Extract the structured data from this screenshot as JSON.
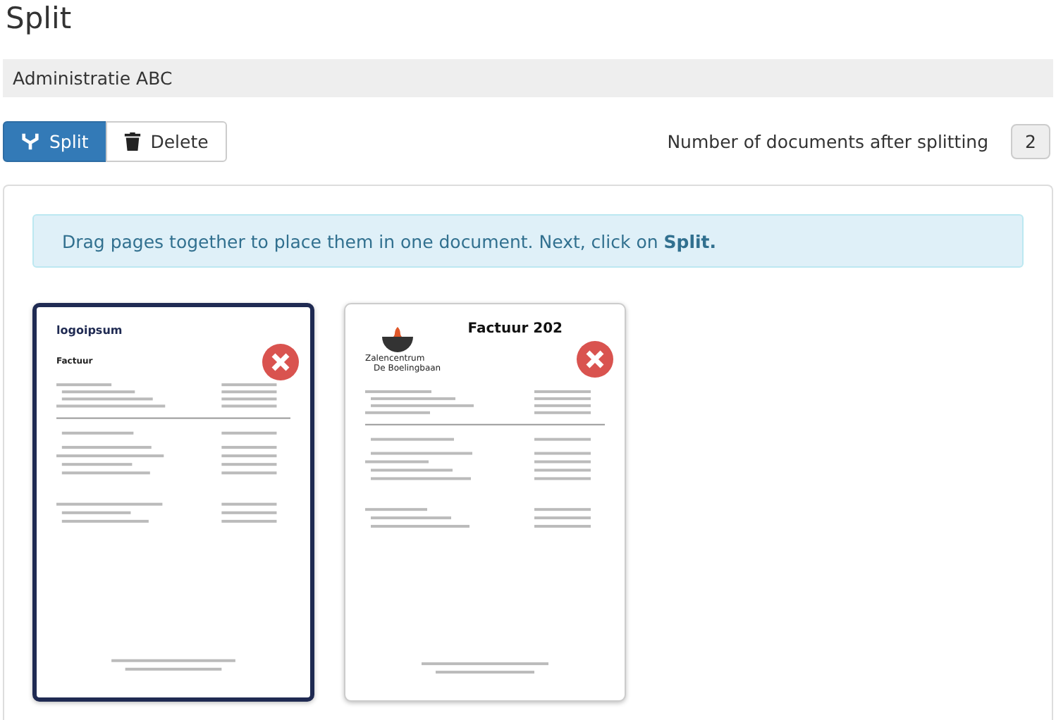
{
  "title": "Split",
  "administration": "Administratie ABC",
  "toolbar": {
    "buttons": [
      {
        "kind": "split",
        "label": "Split"
      },
      {
        "kind": "delete",
        "label": "Delete"
      }
    ],
    "count_label": "Number of documents after splitting",
    "count": "2"
  },
  "info": "Drag pages together to place them in one document. Next, click on **Split.**",
  "pages": [
    {
      "selected": true,
      "kind": "logo",
      "headings": [
        "logoipsum",
        "Factuur"
      ]
    },
    {
      "selected": false,
      "kind": "venue",
      "headings": [
        "Factuur 202",
        "Zalencentrum",
        "De Boelingbaan"
      ]
    }
  ]
}
